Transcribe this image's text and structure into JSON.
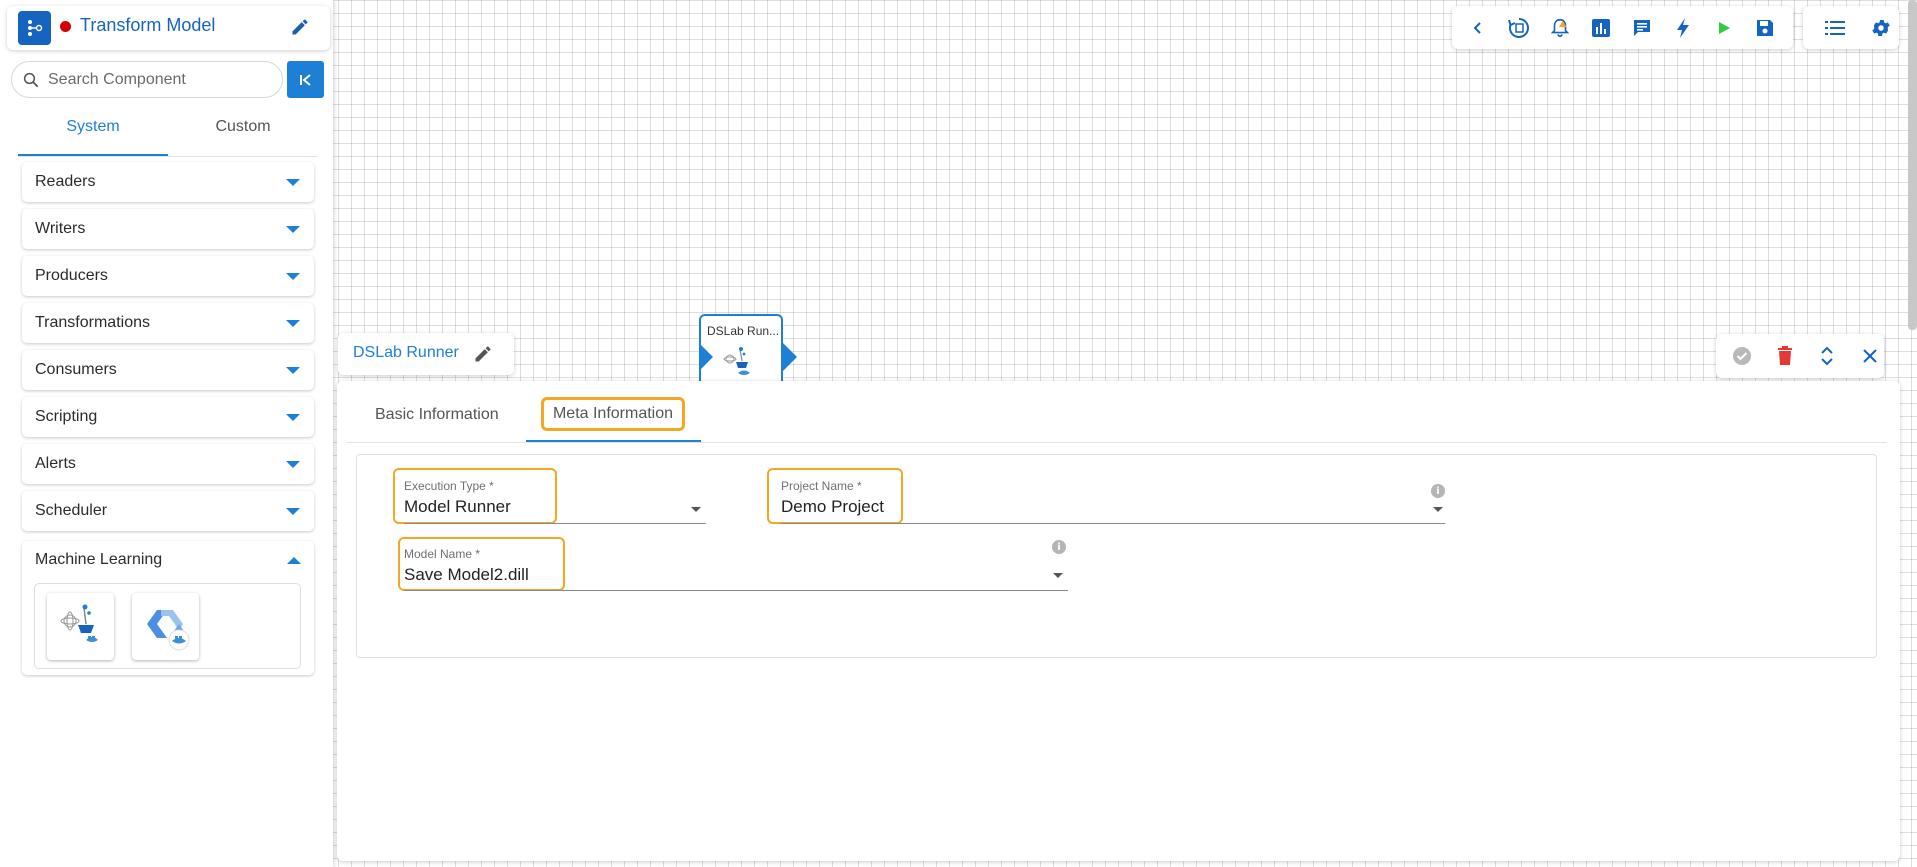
{
  "header": {
    "pipeline_title": "Transform Model",
    "status_color": "#d50000"
  },
  "sidebar": {
    "search_placeholder": "Search Component",
    "tabs": [
      {
        "label": "System",
        "active": true
      },
      {
        "label": "Custom",
        "active": false
      }
    ],
    "categories": [
      {
        "label": "Readers",
        "expanded": false
      },
      {
        "label": "Writers",
        "expanded": false
      },
      {
        "label": "Producers",
        "expanded": false
      },
      {
        "label": "Transformations",
        "expanded": false
      },
      {
        "label": "Consumers",
        "expanded": false
      },
      {
        "label": "Scripting",
        "expanded": false
      },
      {
        "label": "Alerts",
        "expanded": false
      },
      {
        "label": "Scheduler",
        "expanded": false
      },
      {
        "label": "Machine Learning",
        "expanded": true
      }
    ],
    "ml_components": [
      {
        "icon": "dslab-runner-icon"
      },
      {
        "icon": "automl-runner-icon"
      }
    ]
  },
  "toolbar": {
    "items": [
      "back-icon",
      "pipeline-history-icon",
      "alerts-icon",
      "monitor-icon",
      "logs-icon",
      "activate-icon",
      "run-icon",
      "save-icon",
      "list-icon",
      "settings-icon"
    ]
  },
  "canvas": {
    "node_label": "DSLab Run..."
  },
  "component": {
    "name": "DSLab Runner"
  },
  "config": {
    "tabs": [
      {
        "label": "Basic Information",
        "active": false
      },
      {
        "label": "Meta Information",
        "active": true
      }
    ],
    "fields": {
      "execution_type": {
        "label": "Execution Type *",
        "value": "Model Runner"
      },
      "project_name": {
        "label": "Project Name *",
        "value": "Demo Project"
      },
      "model_name": {
        "label": "Model Name *",
        "value": "Save Model2.dill"
      }
    }
  },
  "colors": {
    "accent": "#1e7fd6",
    "highlight": "#f5a623",
    "delete": "#e53935",
    "run": "#2ecc40"
  }
}
